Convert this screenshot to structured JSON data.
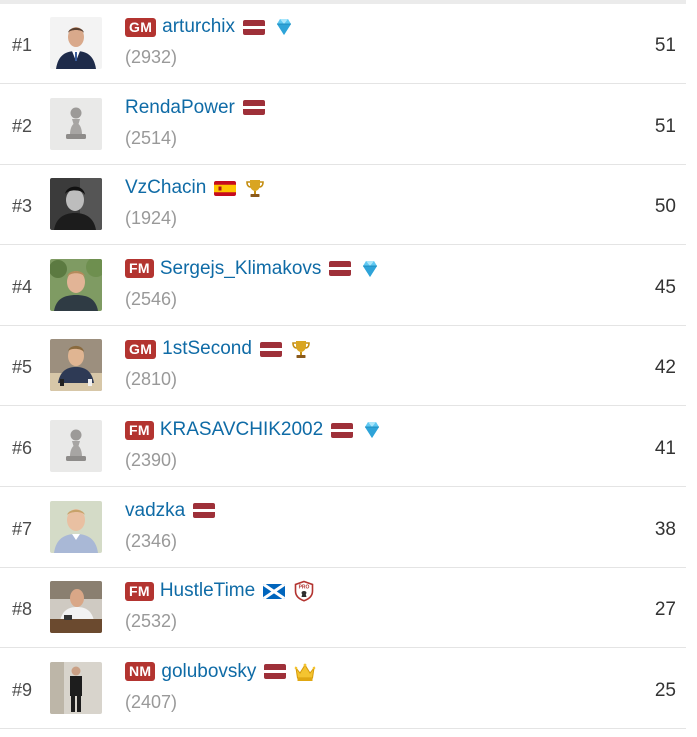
{
  "leaderboard": {
    "rows": [
      {
        "rank": "#1",
        "title": "GM",
        "username": "arturchix",
        "flag": "latvia",
        "membership": "diamond-icon",
        "rating": "(2932)",
        "score": "51",
        "avatar": "photo-suit"
      },
      {
        "rank": "#2",
        "title": "",
        "username": "RendaPower",
        "flag": "latvia",
        "membership": "",
        "rating": "(2514)",
        "score": "51",
        "avatar": "default-pawn"
      },
      {
        "rank": "#3",
        "title": "",
        "username": "VzChacin",
        "flag": "spain",
        "membership": "trophy-icon",
        "rating": "(1924)",
        "score": "50",
        "avatar": "photo-bw"
      },
      {
        "rank": "#4",
        "title": "FM",
        "username": "Sergejs_Klimakovs",
        "flag": "latvia",
        "membership": "diamond-icon",
        "rating": "(2546)",
        "score": "45",
        "avatar": "photo-outdoor"
      },
      {
        "rank": "#5",
        "title": "GM",
        "username": "1stSecond",
        "flag": "latvia",
        "membership": "trophy-icon",
        "rating": "(2810)",
        "score": "42",
        "avatar": "photo-chess"
      },
      {
        "rank": "#6",
        "title": "FM",
        "username": "KRASAVCHIK2002",
        "flag": "latvia",
        "membership": "diamond-icon",
        "rating": "(2390)",
        "score": "41",
        "avatar": "default-pawn"
      },
      {
        "rank": "#7",
        "title": "",
        "username": "vadzka",
        "flag": "latvia",
        "membership": "",
        "rating": "(2346)",
        "score": "38",
        "avatar": "photo-shirt"
      },
      {
        "rank": "#8",
        "title": "FM",
        "username": "HustleTime",
        "flag": "scotland",
        "membership": "pro-shield-icon",
        "rating": "(2532)",
        "score": "27",
        "avatar": "photo-table"
      },
      {
        "rank": "#9",
        "title": "NM",
        "username": "golubovsky",
        "flag": "latvia",
        "membership": "crown-icon",
        "rating": "(2407)",
        "score": "25",
        "avatar": "photo-standing"
      }
    ]
  },
  "colors": {
    "title_badge": "#b33430",
    "username_link": "#0f6ba6",
    "rating_text": "#999999",
    "divider": "#e4e4e4"
  }
}
